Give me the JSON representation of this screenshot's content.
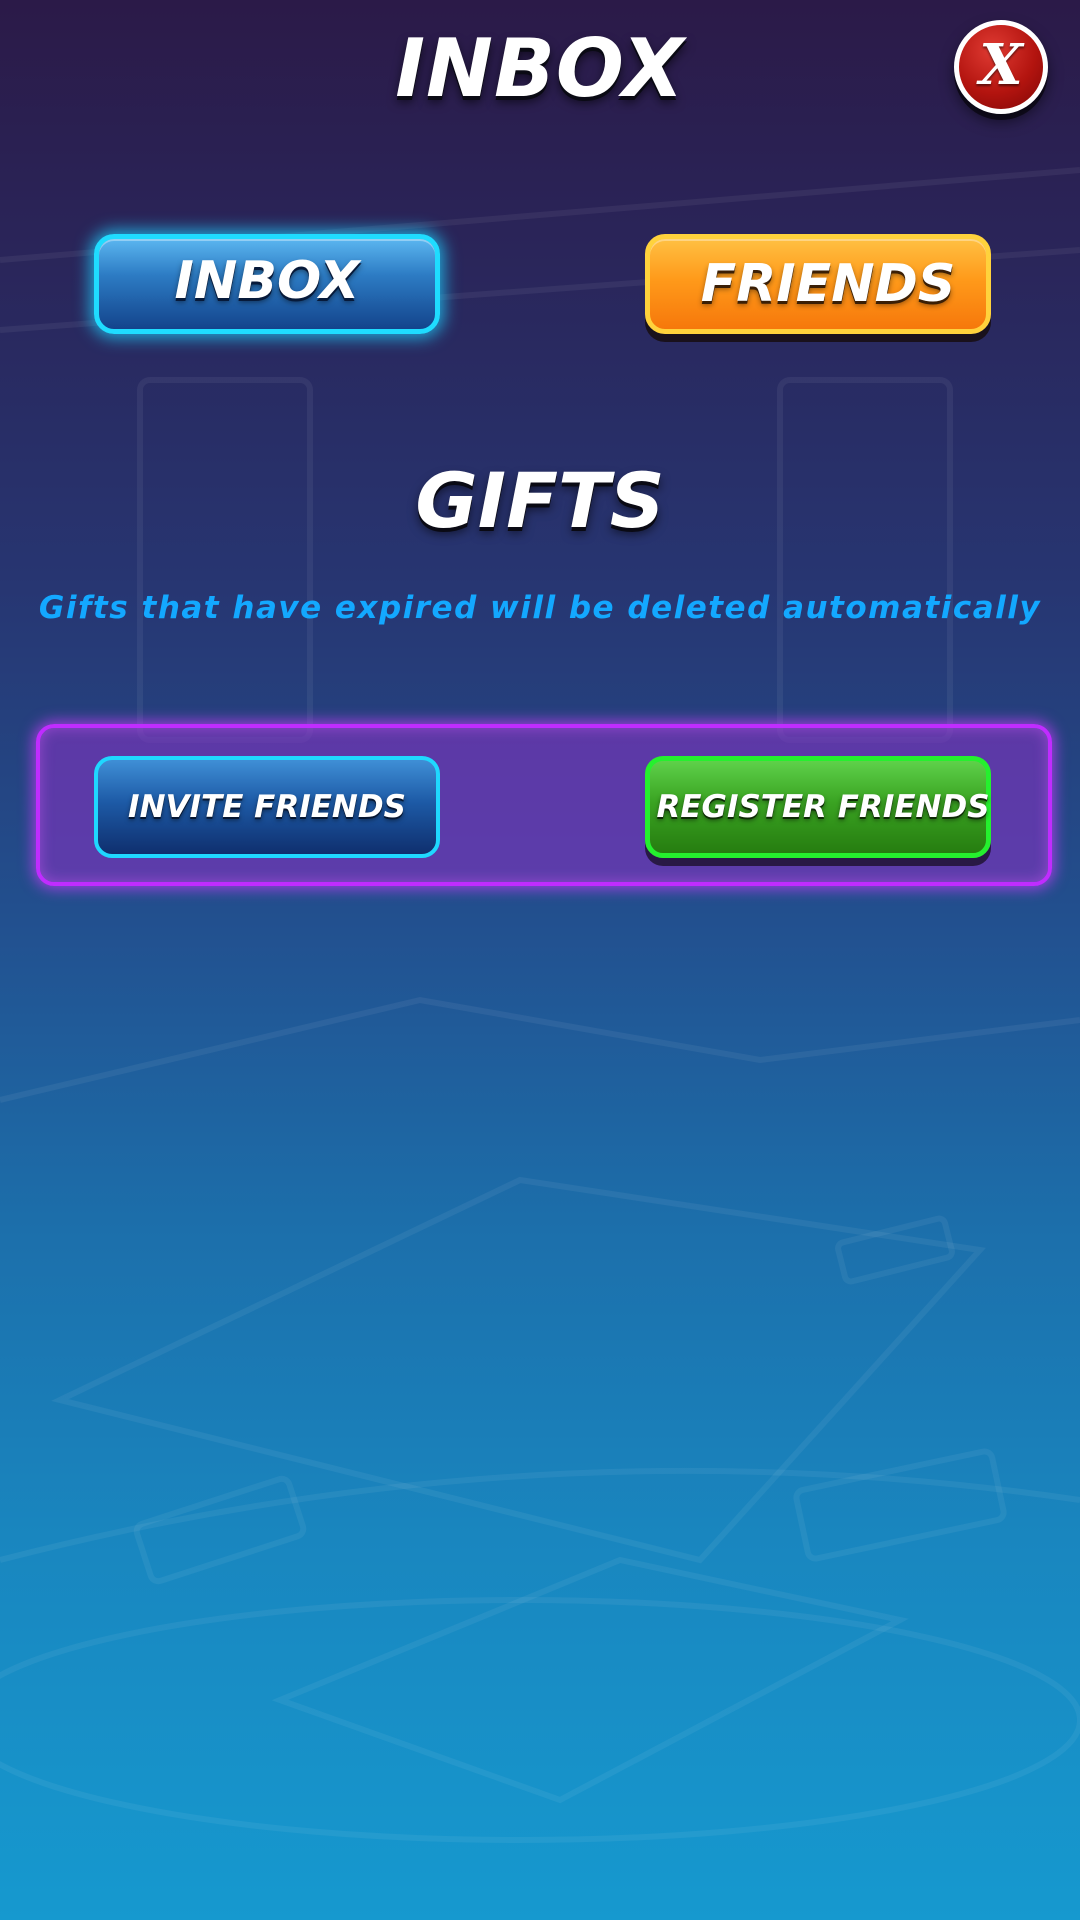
{
  "header": {
    "title": "INBOX",
    "close_label": "X",
    "close_icon": "close-icon"
  },
  "tabs": [
    {
      "label": "INBOX",
      "active": true,
      "color": "#1fdcff"
    },
    {
      "label": "FRIENDS",
      "active": false,
      "color": "#ff9a1a"
    }
  ],
  "gifts": {
    "title": "GIFTS",
    "notice": "Gifts that have expired will be deleted automatically"
  },
  "actions": {
    "invite_label": "INVITE FRIENDS",
    "register_label": "REGISTER FRIENDS"
  },
  "colors": {
    "notice_text": "#13a8ff",
    "panel_border": "#c02cff",
    "close_red": "#b3140f",
    "register_green": "#3aa322"
  }
}
